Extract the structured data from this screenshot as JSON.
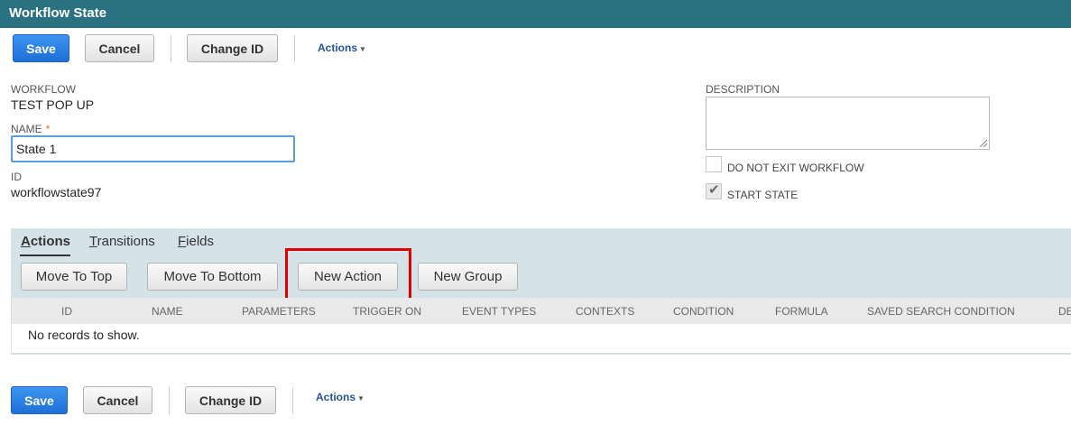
{
  "header": {
    "title": "Workflow State"
  },
  "toolbar": {
    "save": "Save",
    "cancel": "Cancel",
    "change_id": "Change ID",
    "actions": "Actions"
  },
  "form": {
    "workflow_label": "WORKFLOW",
    "workflow_value": "TEST POP UP",
    "name_label": "NAME",
    "required_marker": "*",
    "name_value": "State 1",
    "id_label": "ID",
    "id_value": "workflowstate97",
    "description_label": "DESCRIPTION",
    "description_value": "",
    "do_not_exit": {
      "label": "DO NOT EXIT WORKFLOW",
      "checked": false
    },
    "start_state": {
      "label": "START STATE",
      "checked": true
    }
  },
  "subtabs": {
    "actions": {
      "u": "A",
      "rest": "ctions"
    },
    "transitions": {
      "u": "T",
      "rest": "ransitions"
    },
    "fields": {
      "u": "F",
      "rest": "ields"
    }
  },
  "sublist_buttons": {
    "move_to_top": "Move To Top",
    "move_to_bottom": "Move To Bottom",
    "new_action": "New Action",
    "new_group": "New Group"
  },
  "table": {
    "columns": [
      "ID",
      "NAME",
      "PARAMETERS",
      "TRIGGER ON",
      "EVENT TYPES",
      "CONTEXTS",
      "CONDITION",
      "FORMULA",
      "SAVED SEARCH CONDITION",
      "DE"
    ],
    "empty_message": "No records to show."
  },
  "icons": {
    "caret": "caret-down-icon",
    "check": "checkmark-icon",
    "resize": "resize-grip-icon"
  },
  "colors": {
    "titlebar": "#2a7181",
    "primary_button": "#1f6fd8",
    "highlight": "#e00000",
    "subpanel": "#d5e3e8"
  }
}
